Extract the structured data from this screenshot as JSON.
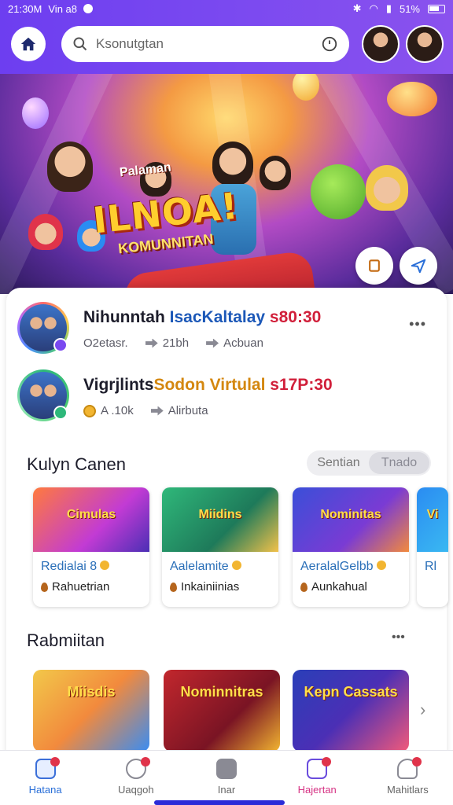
{
  "status_bar": {
    "time": "21:30M",
    "carrier": "Vin a8",
    "battery": "51%"
  },
  "header": {
    "search_placeholder": "Ksonutgtan"
  },
  "hero": {
    "pretitle": "Palaman",
    "title": "ILNOA!",
    "subtitle": "KOMUNNITAN"
  },
  "feed": [
    {
      "title_a": "Nihunntah ",
      "title_b": "IsacKaltalay",
      "title_c": " s80:30",
      "meta1": "O2etasr.",
      "meta2": "21bh",
      "meta3": "Acbuan",
      "badge_color": "#7a49f0"
    },
    {
      "title_a": "Vigrjlints",
      "title_b": "Sodon Virtulal",
      "title_c": " s17P:30",
      "meta1": "A .10k",
      "meta2": "Alirbuta",
      "badge_color": "#2eb87a"
    }
  ],
  "section1": {
    "title": "Kulyn Canen",
    "seg_left": "Sentian",
    "seg_right": "Tnado"
  },
  "tiles": [
    {
      "thumb_text": "Cimulas",
      "cap1": "Redialai 8",
      "cap2": "Rahuetrian",
      "bg": "linear-gradient(135deg,#ff7a3d,#c23bd4 60%,#4b2fb5)"
    },
    {
      "thumb_text": "Miidins",
      "cap1": "Aalelamite",
      "cap2": "Inkainiinias",
      "bg": "linear-gradient(135deg,#2fb87a,#1e7a5a 60%,#f2c14a)"
    },
    {
      "thumb_text": "Nominitas",
      "cap1": "AeralalGelbb",
      "cap2": "Aunkahual",
      "bg": "linear-gradient(135deg,#3a4fd8,#7a3bd4 60%,#f28a3d)"
    },
    {
      "thumb_text": "Vi",
      "cap1": "Rl",
      "cap2": "",
      "bg": "linear-gradient(135deg,#2a8cf2,#3ab8f2)"
    }
  ],
  "section2": {
    "title": "Rabmiitan",
    "more": "•••"
  },
  "tiles2": [
    {
      "text": "Miisdis",
      "bg": "linear-gradient(135deg,#f2c84a,#f28a3d 50%,#3a8cf2)"
    },
    {
      "text": "Nominnitras",
      "bg": "linear-gradient(135deg,#c2272d,#7a1424 60%,#f2b531)"
    },
    {
      "text": "Kepn Cassats",
      "bg": "linear-gradient(135deg,#2a3fb8,#4b2fb5 50%,#f25a7a)"
    }
  ],
  "bottom_nav": [
    {
      "label": "Hatana",
      "icon": "home-icon"
    },
    {
      "label": "Uaqgoh",
      "icon": "chat-icon"
    },
    {
      "label": "Inar",
      "icon": "close-icon"
    },
    {
      "label": "Hajertan",
      "icon": "tv-icon"
    },
    {
      "label": "Mahitlars",
      "icon": "user-icon"
    }
  ]
}
